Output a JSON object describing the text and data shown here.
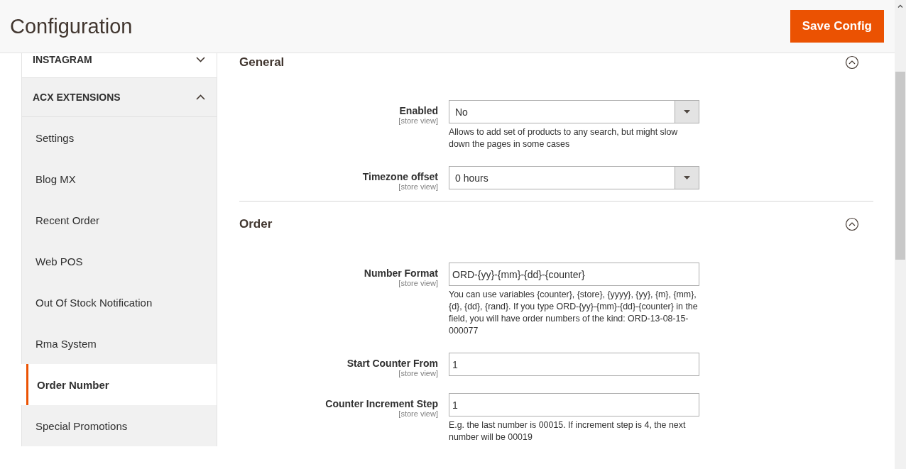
{
  "header": {
    "title": "Configuration",
    "save_button": "Save Config"
  },
  "sidebar": {
    "groups": [
      {
        "title": "INSTAGRAM",
        "expanded": false
      },
      {
        "title": "ACX EXTENSIONS",
        "expanded": true,
        "items": [
          {
            "label": "Settings",
            "selected": false
          },
          {
            "label": "Blog MX",
            "selected": false
          },
          {
            "label": "Recent Order",
            "selected": false
          },
          {
            "label": "Web POS",
            "selected": false
          },
          {
            "label": "Out Of Stock Notification",
            "selected": false
          },
          {
            "label": "Rma System",
            "selected": false
          },
          {
            "label": "Order Number",
            "selected": true
          },
          {
            "label": "Special Promotions",
            "selected": false
          }
        ]
      }
    ]
  },
  "sections": [
    {
      "title": "General",
      "expanded": true,
      "fields": [
        {
          "kind": "select",
          "label": "Enabled",
          "scope": "[store view]",
          "value": "No",
          "note": "Allows to add set of products to any search, but might slow down the pages in some cases"
        },
        {
          "kind": "select",
          "label": "Timezone offset",
          "scope": "[store view]",
          "value": "0 hours"
        }
      ]
    },
    {
      "title": "Order",
      "expanded": true,
      "fields": [
        {
          "kind": "text",
          "label": "Number Format",
          "scope": "[store view]",
          "value": "ORD-{yy}-{mm}-{dd}-{counter}",
          "note": "You can use variables {counter}, {store}, {yyyy}, {yy}, {m}, {mm}, {d}, {dd}, {rand}. If you type ORD-{yy}-{mm}-{dd}-{counter} in the field, you will have order numbers of the kind: ORD-13-08-15-000077"
        },
        {
          "kind": "text",
          "label": "Start Counter From",
          "scope": "[store view]",
          "value": "1"
        },
        {
          "kind": "text",
          "label": "Counter Increment Step",
          "scope": "[store view]",
          "value": "1",
          "note": "E.g. the last number is 00015. If increment step is 4, the next number will be 00019"
        }
      ]
    }
  ]
}
